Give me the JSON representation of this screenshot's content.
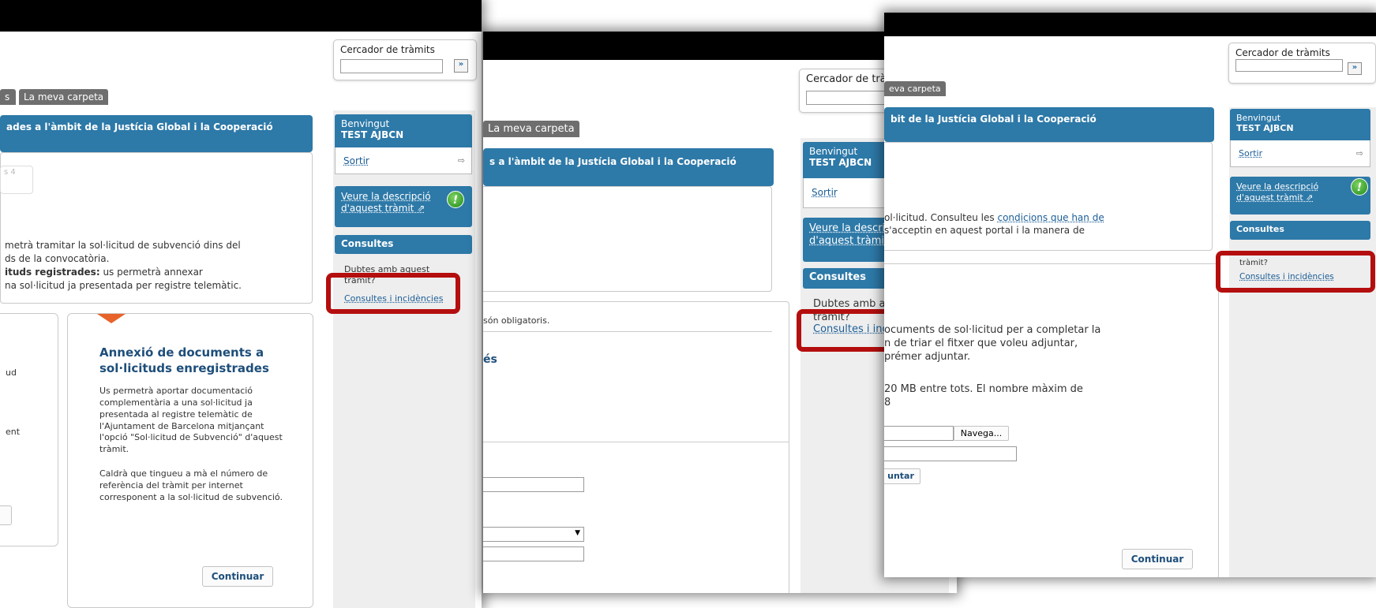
{
  "common": {
    "search_label": "Cercador de tràmits",
    "search_go": "»",
    "tab_folder": "La meva carpeta",
    "welcome_prefix": "Benvingut",
    "user_name": "TEST AJBCN",
    "logout": "Sortir",
    "logout_icon": "logout-arrow-icon",
    "desc_line1": "Veure la descripció",
    "desc_line2": "d'aquest tràmit",
    "desc_icon": "external-link-icon",
    "alert_icon": "exclamation-icon",
    "alert_glyph": "!",
    "consultes_title": "Consultes",
    "dubtes_line1": "Dubtes amb aquest",
    "dubtes_line2": "tràmit?",
    "consultes_link": "Consultes i incidències",
    "continue": "Continuar",
    "highlight_color": "#b40e0e",
    "accent_color": "#2d79a8"
  },
  "shot1": {
    "tab_prev_fragment": "s",
    "title_bar": "ades a l'àmbit de la Justícia Global i la Cooperació",
    "pager_fragment": "s 4",
    "intro": [
      "metrà tramitar la sol·licitud de subvenció dins del",
      "ds de la convocatòria."
    ],
    "intro_bold": "ituds registrades:",
    "intro_bold_rest": " us permetrà annexar",
    "intro_last": "na sol·licitud ja presentada per registre telemàtic.",
    "left_card_frag1": "ud",
    "left_card_frag2": "ent",
    "card_title": "Annexió de documents a sol·licituds enregistrades",
    "card_p1": "Us permetrà aportar documentació complementària a una sol·licitud ja presentada al registre telemàtic de l'Ajuntament de Barcelona mitjançant l'opció \"Sol·licitud de Subvenció\" d'aquest tràmit.",
    "card_p2": "Caldrà que tingueu a mà el número de referència del tràmit per internet corresponent a la sol·licitud de subvenció."
  },
  "shot2": {
    "title_bar": "s a l'àmbit de la Justícia Global i la Cooperació",
    "required_note": "són obligatoris.",
    "section_fragment": "és"
  },
  "shot3": {
    "tab_fragment": "eva carpeta",
    "title_bar": "bit de la Justícia Global i la Cooperació",
    "intro_line1_a": "ol·licitud. Consulteu les ",
    "intro_link": "condicions que han de",
    "intro_line2": "s'acceptin en aquest portal i la manera de",
    "upload_lines": [
      "ocuments de sol·licitud per a completar la",
      "n de triar el fitxer que voleu adjuntar,",
      "prémer adjuntar."
    ],
    "limit_lines": [
      "20 MB entre tots. El nombre màxim de",
      "8"
    ],
    "browse_button": "Navega...",
    "attach_fragment": "untar"
  }
}
